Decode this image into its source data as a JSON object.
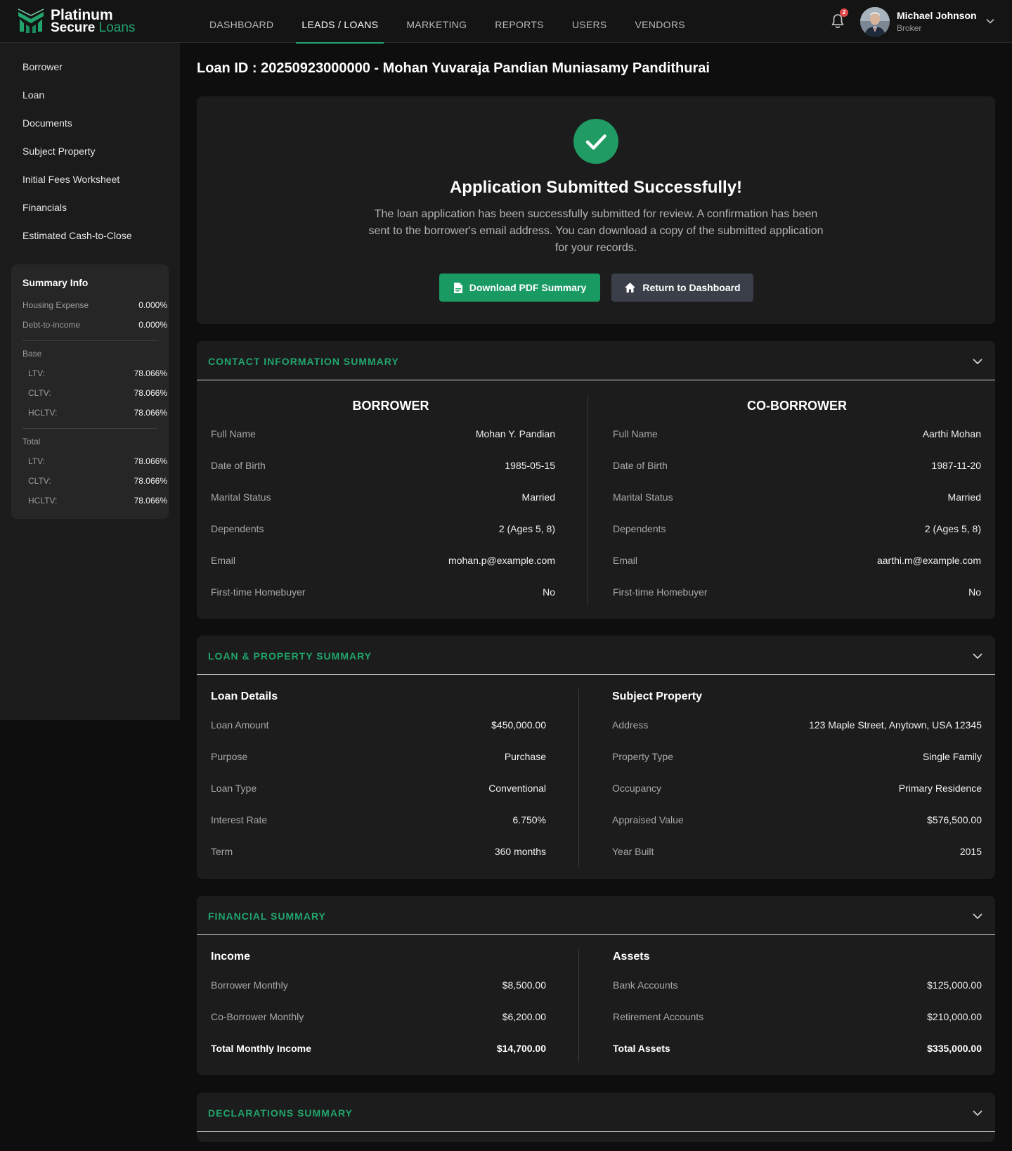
{
  "brand": {
    "name_line1": "Platinum",
    "name_line2a": "Secure",
    "name_line2b": "Loans",
    "accent": "#21a56d"
  },
  "nav": {
    "items": [
      "DASHBOARD",
      "LEADS / LOANS",
      "MARKETING",
      "REPORTS",
      "USERS",
      "VENDORS"
    ],
    "active_index": 1
  },
  "header": {
    "notifications": "2",
    "user_name": "Michael Johnson",
    "user_role": "Broker"
  },
  "sidebar": {
    "items": [
      "Borrower",
      "Loan",
      "Documents",
      "Subject Property",
      "Initial Fees Worksheet",
      "Financials",
      "Estimated Cash-to-Close"
    ],
    "summary": {
      "title": "Summary Info",
      "housing_expense_label": "Housing Expense",
      "housing_expense_value": "0.000%",
      "dti_label": "Debt-to-income",
      "dti_value": "0.000%",
      "base_label": "Base",
      "base": [
        {
          "label": "LTV:",
          "value": "78.066%"
        },
        {
          "label": "CLTV:",
          "value": "78.066%"
        },
        {
          "label": "HCLTV:",
          "value": "78.066%"
        }
      ],
      "total_label": "Total",
      "total": [
        {
          "label": "LTV:",
          "value": "78.066%"
        },
        {
          "label": "CLTV:",
          "value": "78.066%"
        },
        {
          "label": "HCLTV:",
          "value": "78.066%"
        }
      ]
    }
  },
  "page": {
    "title": "Loan ID : 20250923000000 - Mohan Yuvaraja Pandian Muniasamy Pandithurai"
  },
  "success": {
    "title": "Application Submitted Successfully!",
    "message": "The loan application has been successfully submitted for review. A confirmation has been sent to the borrower's email address. You can download a copy of the submitted application for your records.",
    "download_label": "Download PDF Summary",
    "dashboard_label": "Return to Dashboard"
  },
  "contact": {
    "title": "CONTACT INFORMATION SUMMARY",
    "borrower_heading": "BORROWER",
    "coborrower_heading": "CO-BORROWER",
    "borrower": [
      {
        "label": "Full Name",
        "value": "Mohan Y. Pandian"
      },
      {
        "label": "Date of Birth",
        "value": "1985-05-15"
      },
      {
        "label": "Marital Status",
        "value": "Married"
      },
      {
        "label": "Dependents",
        "value": "2 (Ages 5, 8)"
      },
      {
        "label": "Email",
        "value": "mohan.p@example.com"
      },
      {
        "label": "First-time Homebuyer",
        "value": "No"
      }
    ],
    "coborrower": [
      {
        "label": "Full Name",
        "value": "Aarthi Mohan"
      },
      {
        "label": "Date of Birth",
        "value": "1987-11-20"
      },
      {
        "label": "Marital Status",
        "value": "Married"
      },
      {
        "label": "Dependents",
        "value": "2 (Ages 5, 8)"
      },
      {
        "label": "Email",
        "value": "aarthi.m@example.com"
      },
      {
        "label": "First-time Homebuyer",
        "value": "No"
      }
    ]
  },
  "loan_property": {
    "title": "LOAN & PROPERTY SUMMARY",
    "loan_heading": "Loan Details",
    "property_heading": "Subject Property",
    "loan": [
      {
        "label": "Loan Amount",
        "value": "$450,000.00"
      },
      {
        "label": "Purpose",
        "value": "Purchase"
      },
      {
        "label": "Loan Type",
        "value": "Conventional"
      },
      {
        "label": "Interest Rate",
        "value": "6.750%"
      },
      {
        "label": "Term",
        "value": "360 months"
      }
    ],
    "property": [
      {
        "label": "Address",
        "value": "123 Maple Street, Anytown, USA 12345"
      },
      {
        "label": "Property Type",
        "value": "Single Family"
      },
      {
        "label": "Occupancy",
        "value": "Primary Residence"
      },
      {
        "label": "Appraised Value",
        "value": "$576,500.00"
      },
      {
        "label": "Year Built",
        "value": "2015"
      }
    ]
  },
  "financial": {
    "title": "FINANCIAL SUMMARY",
    "income_heading": "Income",
    "assets_heading": "Assets",
    "income": [
      {
        "label": "Borrower Monthly",
        "value": "$8,500.00"
      },
      {
        "label": "Co-Borrower Monthly",
        "value": "$6,200.00"
      },
      {
        "label": "Total Monthly Income",
        "value": "$14,700.00"
      }
    ],
    "assets": [
      {
        "label": "Bank Accounts",
        "value": "$125,000.00"
      },
      {
        "label": "Retirement Accounts",
        "value": "$210,000.00"
      },
      {
        "label": "Total Assets",
        "value": "$335,000.00"
      }
    ]
  },
  "declarations": {
    "title": "DECLARATIONS SUMMARY"
  }
}
